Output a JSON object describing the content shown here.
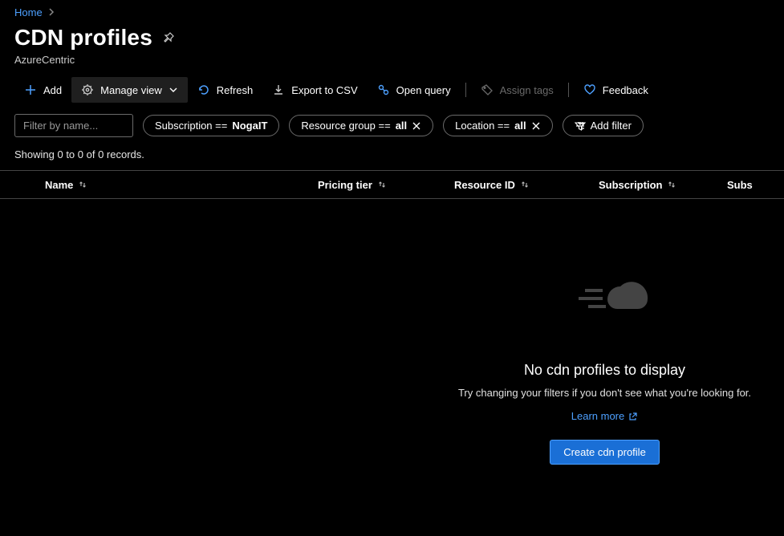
{
  "breadcrumb": {
    "home": "Home"
  },
  "header": {
    "title": "CDN profiles",
    "subtitle": "AzureCentric"
  },
  "toolbar": {
    "add": "Add",
    "manageView": "Manage view",
    "refresh": "Refresh",
    "exportCsv": "Export to CSV",
    "openQuery": "Open query",
    "assignTags": "Assign tags",
    "feedback": "Feedback"
  },
  "filters": {
    "placeholder": "Filter by name...",
    "subscription": {
      "label": "Subscription == ",
      "value": "NogaIT"
    },
    "resourceGroup": {
      "label": "Resource group == ",
      "value": "all"
    },
    "location": {
      "label": "Location == ",
      "value": "all"
    },
    "addFilter": "Add filter"
  },
  "recordsInfo": "Showing 0 to 0 of 0 records.",
  "columns": {
    "name": "Name",
    "pricingTier": "Pricing tier",
    "resourceId": "Resource ID",
    "subscription": "Subscription",
    "subscriptionId": "Subs"
  },
  "empty": {
    "title": "No cdn profiles to display",
    "subtitle": "Try changing your filters if you don't see what you're looking for.",
    "learnMore": "Learn more",
    "createButton": "Create cdn profile"
  }
}
